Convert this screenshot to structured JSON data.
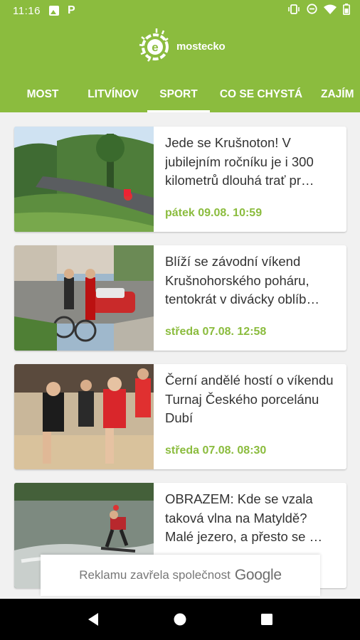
{
  "status_bar": {
    "time": "11:16",
    "left_icons": [
      "image-icon",
      "p-icon"
    ],
    "p_label": "P",
    "right_icons": [
      "vibrate-icon",
      "dnd-icon",
      "wifi-icon",
      "battery-icon"
    ]
  },
  "header": {
    "logo_text": "mostecko",
    "background": "#8bbc3e",
    "accent": "#8bbc3e"
  },
  "tabs": [
    {
      "label": "MOST",
      "active": false
    },
    {
      "label": "LITVÍNOV",
      "active": false
    },
    {
      "label": "SPORT",
      "active": true
    },
    {
      "label": "CO SE CHYSTÁ",
      "active": false
    },
    {
      "label": "ZAJÍM",
      "active": false
    }
  ],
  "articles": [
    {
      "title": "Jede se Krušnoton! V jubilejním ročníku je i 300 kilometrů dlouhá trať pr…",
      "date": "pátek 09.08. 10:59",
      "thumb": "cyclist-road-photo"
    },
    {
      "title": "Blíží se závodní víkend Krušnohorského poháru, tentokrát v divácky oblíb…",
      "date": "středa 07.08. 12:58",
      "thumb": "street-race-spectators-photo"
    },
    {
      "title": "Černí andělé hostí o víkendu Turnaj Českého porcelánu Dubí",
      "date": "středa 07.08. 08:30",
      "thumb": "handball-players-photo"
    },
    {
      "title": "OBRAZEM: Kde se vzala taková vlna na Matyldě? Malé jezero, a přesto se …",
      "date": "",
      "thumb": "wakeboarder-lake-photo"
    }
  ],
  "ad": {
    "text": "Reklamu zavřela společnost",
    "brand": "Google"
  },
  "nav": [
    "back-icon",
    "home-icon",
    "recents-icon"
  ]
}
